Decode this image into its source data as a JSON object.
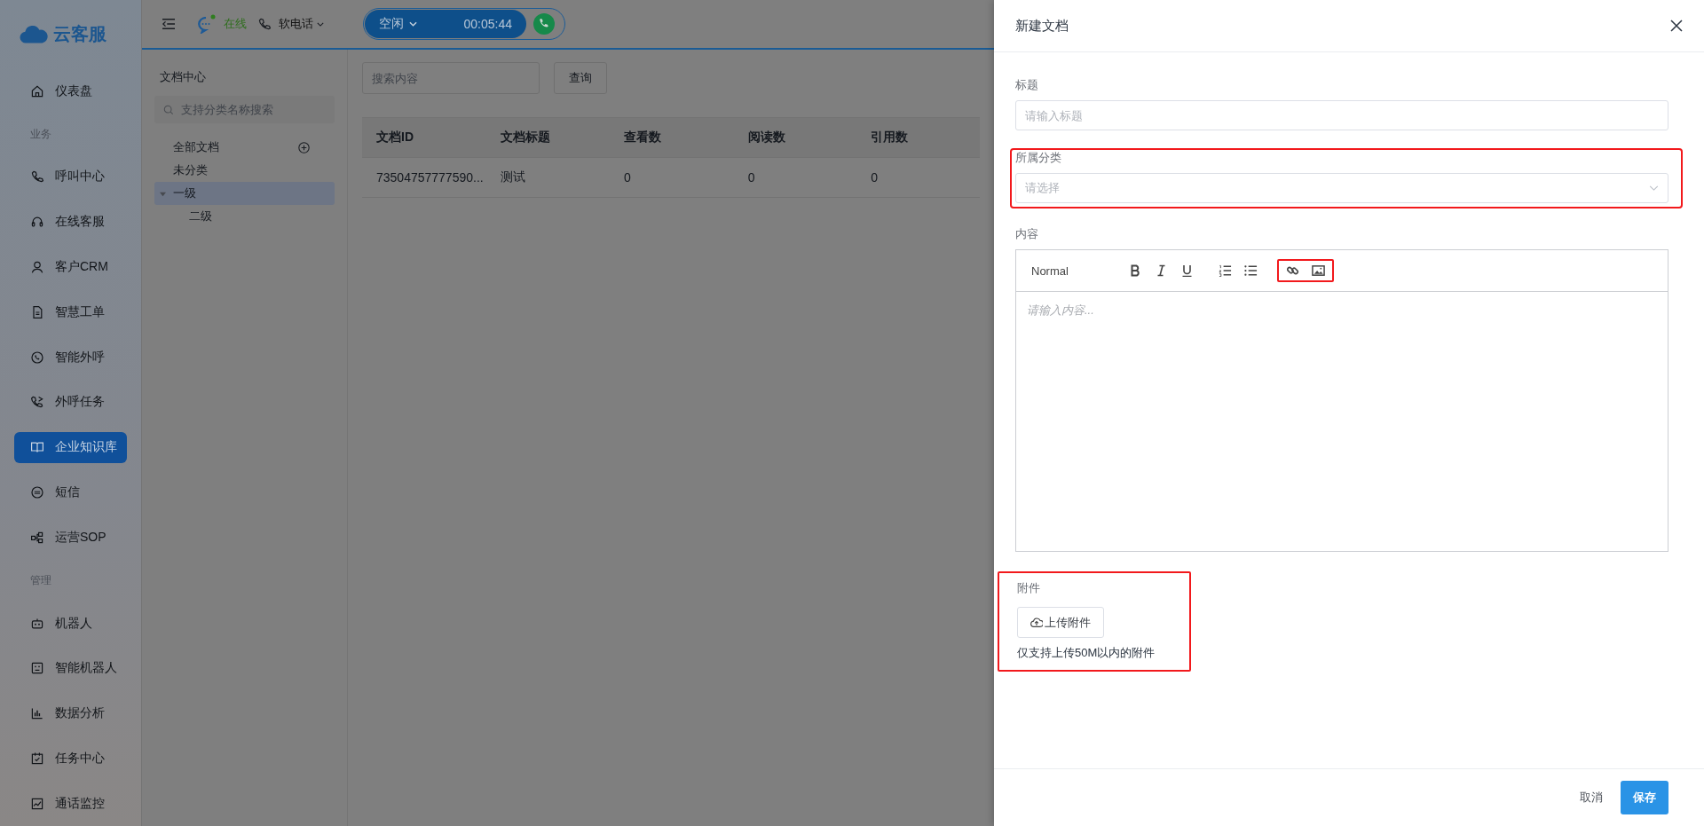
{
  "sidebar": {
    "logo": "云客服",
    "items": [
      {
        "kind": "item",
        "label": "仪表盘",
        "selected": false
      },
      {
        "kind": "section",
        "label": "业务"
      },
      {
        "kind": "item",
        "label": "呼叫中心",
        "selected": false
      },
      {
        "kind": "item",
        "label": "在线客服",
        "selected": false
      },
      {
        "kind": "item",
        "label": "客户CRM",
        "selected": false
      },
      {
        "kind": "item",
        "label": "智慧工单",
        "selected": false
      },
      {
        "kind": "item",
        "label": "智能外呼",
        "selected": false
      },
      {
        "kind": "item",
        "label": "外呼任务",
        "selected": false
      },
      {
        "kind": "item",
        "label": "企业知识库",
        "selected": true
      },
      {
        "kind": "item",
        "label": "短信",
        "selected": false
      },
      {
        "kind": "item",
        "label": "运营SOP",
        "selected": false
      },
      {
        "kind": "section",
        "label": "管理"
      },
      {
        "kind": "item",
        "label": "机器人",
        "selected": false
      },
      {
        "kind": "item",
        "label": "智能机器人",
        "selected": false
      },
      {
        "kind": "item",
        "label": "数据分析",
        "selected": false
      },
      {
        "kind": "item",
        "label": "任务中心",
        "selected": false
      },
      {
        "kind": "item",
        "label": "通话监控",
        "selected": false
      }
    ]
  },
  "topbar": {
    "online_status": "在线",
    "phone_mode": "软电话",
    "call_state": "空闲",
    "timer": "00:05:44"
  },
  "doc_panel": {
    "title": "文档中心",
    "search": {
      "placeholder": "支持分类名称搜索"
    },
    "tree": [
      {
        "label": "全部文档",
        "selected": false,
        "addable": true
      },
      {
        "label": "未分类",
        "selected": false,
        "addable": false
      },
      {
        "label": "一级",
        "selected": true,
        "addable": false,
        "expanded": true,
        "children": [
          {
            "label": "二级",
            "selected": false
          }
        ]
      }
    ]
  },
  "main": {
    "search": {
      "placeholder": "搜索内容"
    },
    "query_button": "查询",
    "table": {
      "columns": [
        "文档ID",
        "文档标题",
        "查看数",
        "阅读数",
        "引用数"
      ],
      "rows": [
        [
          "73504757777590...",
          "测试",
          "0",
          "0",
          "0"
        ]
      ]
    }
  },
  "drawer": {
    "title": "新建文档",
    "fields": [
      {
        "kind": "input",
        "label": "标题",
        "placeholder": "请输入标题",
        "highlighted": false
      },
      {
        "kind": "select",
        "label": "所属分类",
        "placeholder": "请选择",
        "highlighted": true
      },
      {
        "kind": "editor",
        "label": "内容",
        "placeholder": "请输入内容...",
        "format": "Normal",
        "media_highlighted": true,
        "highlighted": false
      }
    ],
    "attachment": {
      "label": "附件",
      "button": "上传附件",
      "hint": "仅支持上传50M以内的附件",
      "highlighted": true
    },
    "cancel": "取消",
    "save": "保存"
  }
}
